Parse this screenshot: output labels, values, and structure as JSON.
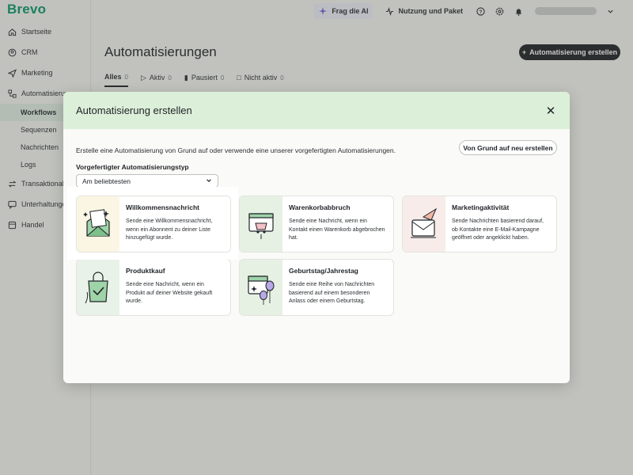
{
  "app": {
    "logo": "Brevo"
  },
  "sidebar": {
    "items": [
      {
        "label": "Startseite",
        "icon": "home-icon"
      },
      {
        "label": "CRM",
        "icon": "contacts-icon"
      },
      {
        "label": "Marketing",
        "icon": "send-icon"
      },
      {
        "label": "Automatisierungen",
        "icon": "automation-icon"
      },
      {
        "label": "Workflows",
        "sub": true,
        "active": true
      },
      {
        "label": "Sequenzen",
        "sub": true
      },
      {
        "label": "Nachrichten",
        "sub": true
      },
      {
        "label": "Logs",
        "sub": true
      },
      {
        "label": "Transaktionale",
        "icon": "transactional-icon"
      },
      {
        "label": "Unterhaltungen",
        "icon": "chat-icon"
      },
      {
        "label": "Handel",
        "icon": "shop-icon"
      }
    ]
  },
  "topbar": {
    "ai_label": "Frag die AI",
    "usage_label": "Nutzung und Paket"
  },
  "page": {
    "title": "Automatisierungen",
    "create_label": "Automatisierung erstellen",
    "tabs": [
      {
        "label": "Alles",
        "count": "0"
      },
      {
        "label": "Aktiv",
        "count": "0"
      },
      {
        "label": "Pausiert",
        "count": "0"
      },
      {
        "label": "Nicht aktiv",
        "count": "0"
      }
    ]
  },
  "modal": {
    "title": "Automatisierung erstellen",
    "description": "Erstelle eine Automatisierung von Grund auf oder verwende eine unserer vorgefertigten Automatisierungen.",
    "scratch_label": "Von Grund auf neu erstellen",
    "type_label": "Vorgefertigter Automatisierungstyp",
    "type_selected": "Am beliebtesten",
    "cards": [
      {
        "title": "Willkommensnachricht",
        "desc": "Sende eine Willkommensnachricht, wenn ein Abonnent zu deiner Liste hinzugefügt wurde."
      },
      {
        "title": "Warenkorbabbruch",
        "desc": "Sende eine Nachricht, wenn ein Kontakt einen Warenkorb abgebrochen hat."
      },
      {
        "title": "Marketingaktivität",
        "desc": "Sende Nachrichten basierend darauf, ob Kontakte eine E-Mail-Kampagne geöffnet oder angeklickt haben."
      },
      {
        "title": "Produktkauf",
        "desc": "Sende eine Nachricht, wenn ein Produkt auf deiner Website gekauft wurde."
      },
      {
        "title": "Geburtstag/Jahrestag",
        "desc": "Sende eine Reihe von Nachrichten basierend auf einem besonderen Anlass oder einem Geburtstag."
      }
    ]
  },
  "colors": {
    "brand": "#0b996e",
    "header_green": "#dcefd9",
    "dark": "#1f2328"
  }
}
